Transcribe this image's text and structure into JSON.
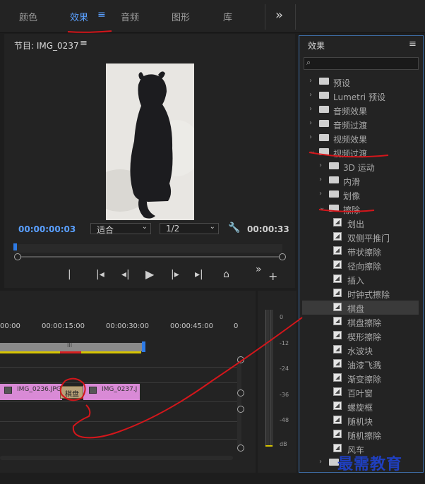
{
  "top_tabs": [
    "颜色",
    "效果",
    "音频",
    "图形",
    "库"
  ],
  "active_tab": "效果",
  "overflow_glyph": "»",
  "program": {
    "title": "节目: IMG_0237",
    "timecode_current": "00:00:00:03",
    "timecode_duration": "00:00:33",
    "fit_label": "适合",
    "resolution_label": "1/2"
  },
  "effects_panel": {
    "title": "效果",
    "items": [
      {
        "label": "预设",
        "kind": "folder",
        "level": 0,
        "expanded": false
      },
      {
        "label": "Lumetri 预设",
        "kind": "folder",
        "level": 0,
        "expanded": false
      },
      {
        "label": "音频效果",
        "kind": "folder",
        "level": 0,
        "expanded": false
      },
      {
        "label": "音频过渡",
        "kind": "folder",
        "level": 0,
        "expanded": false
      },
      {
        "label": "视频效果",
        "kind": "folder",
        "level": 0,
        "expanded": false
      },
      {
        "label": "视频过渡",
        "kind": "folder",
        "level": 0,
        "expanded": true
      },
      {
        "label": "3D 运动",
        "kind": "folder",
        "level": 1,
        "expanded": false
      },
      {
        "label": "内滑",
        "kind": "folder",
        "level": 1,
        "expanded": false
      },
      {
        "label": "划像",
        "kind": "folder",
        "level": 1,
        "expanded": false
      },
      {
        "label": "擦除",
        "kind": "folder",
        "level": 1,
        "expanded": true
      },
      {
        "label": "划出",
        "kind": "transition",
        "level": 2
      },
      {
        "label": "双侧平推门",
        "kind": "transition",
        "level": 2
      },
      {
        "label": "带状擦除",
        "kind": "transition",
        "level": 2
      },
      {
        "label": "径向擦除",
        "kind": "transition",
        "level": 2
      },
      {
        "label": "插入",
        "kind": "transition",
        "level": 2
      },
      {
        "label": "时钟式擦除",
        "kind": "transition",
        "level": 2
      },
      {
        "label": "棋盘",
        "kind": "transition",
        "level": 2,
        "selected": true
      },
      {
        "label": "棋盘擦除",
        "kind": "transition",
        "level": 2
      },
      {
        "label": "楔形擦除",
        "kind": "transition",
        "level": 2
      },
      {
        "label": "水波块",
        "kind": "transition",
        "level": 2
      },
      {
        "label": "油漆飞溅",
        "kind": "transition",
        "level": 2
      },
      {
        "label": "渐变擦除",
        "kind": "transition",
        "level": 2
      },
      {
        "label": "百叶窗",
        "kind": "transition",
        "level": 2
      },
      {
        "label": "螺旋框",
        "kind": "transition",
        "level": 2
      },
      {
        "label": "随机块",
        "kind": "transition",
        "level": 2
      },
      {
        "label": "随机擦除",
        "kind": "transition",
        "level": 2
      },
      {
        "label": "风车",
        "kind": "transition",
        "level": 2
      },
      {
        "label": "",
        "kind": "folder",
        "level": 1,
        "expanded": false
      }
    ]
  },
  "timeline": {
    "ruler_labels": [
      "00:00",
      "00:00:15:00",
      "00:00:30:00",
      "00:00:45:00",
      "0"
    ],
    "clip_a": "IMG_0236.JPG",
    "clip_b": "IMG_0237.J",
    "transition_label": "棋盘",
    "work_area_marker": "III"
  },
  "meter": {
    "db_labels": [
      "0",
      "-12",
      "-24",
      "-36",
      "-48",
      "dB"
    ]
  },
  "watermark": "最需教育",
  "colors": {
    "accent_blue": "#5aa0ff",
    "clip_pink": "#d98ad6",
    "annotation_red": "#d4161b",
    "watermark_blue": "#1f3fbf"
  }
}
